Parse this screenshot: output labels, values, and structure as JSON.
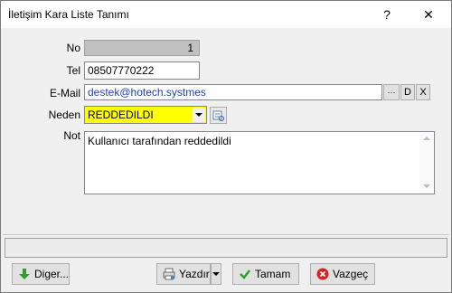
{
  "window": {
    "title": "İletişim Kara Liste Tanımı",
    "help_label": "?",
    "close_label": "✕"
  },
  "form": {
    "no": {
      "label": "No",
      "value": "1"
    },
    "tel": {
      "label": "Tel",
      "value": "08507770222"
    },
    "email": {
      "label": "E-Mail",
      "value": "destek@hotech.systmes",
      "btn_more": "···",
      "btn_d": "D",
      "btn_x": "X"
    },
    "neden": {
      "label": "Neden",
      "value": "REDDEDILDI"
    },
    "not": {
      "label": "Not",
      "value": "Kullanıcı tarafından reddedildi"
    }
  },
  "buttons": {
    "diger": "Diger...",
    "yazdir": "Yazdır",
    "tamam": "Tamam",
    "vazgec": "Vazgeç"
  },
  "colors": {
    "email_text": "#1f3fb3",
    "neden_bg": "#ffff00",
    "no_field_bg": "#c0c0c0"
  },
  "icons": {
    "diger": "green-down-arrow-icon",
    "yazdir": "printer-icon",
    "tamam": "green-check-icon",
    "vazgec": "red-x-icon"
  }
}
